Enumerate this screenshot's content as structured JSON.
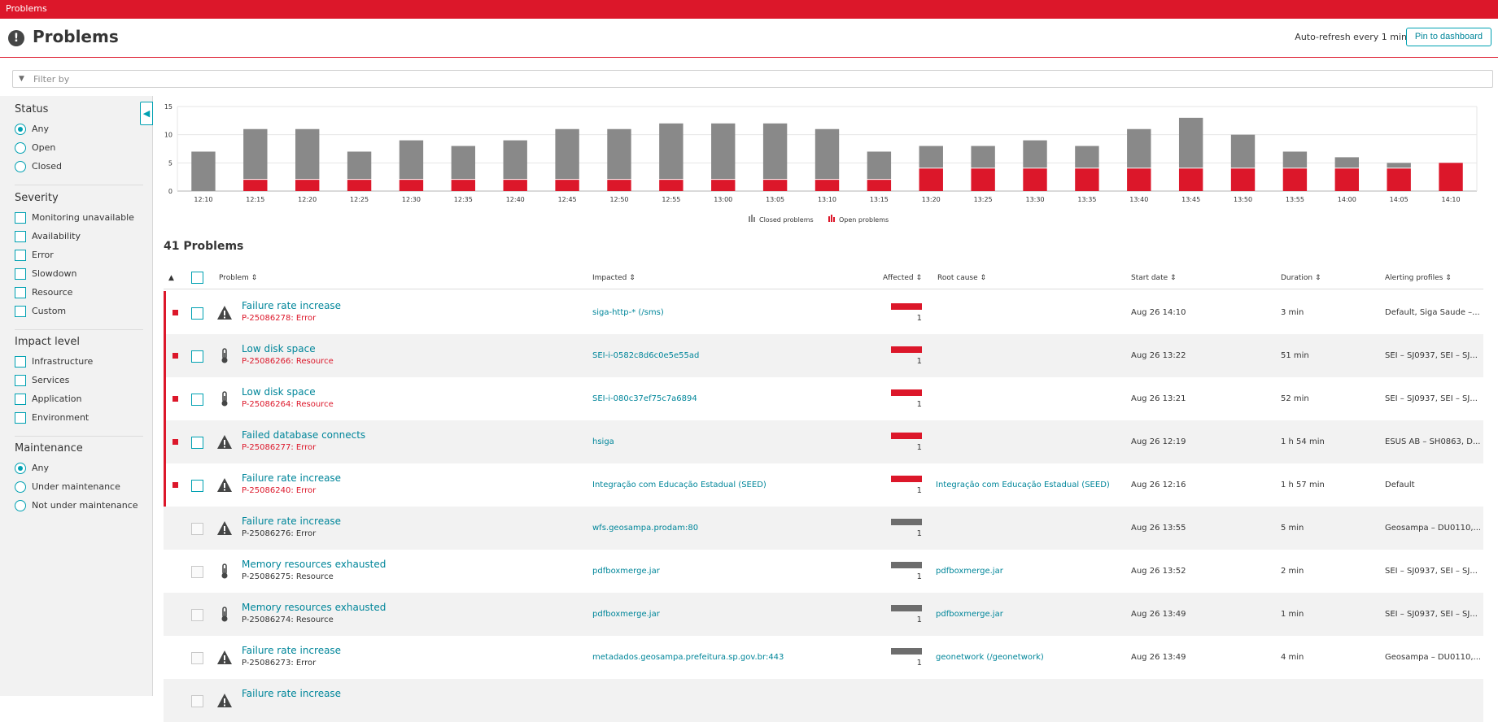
{
  "topbar": {
    "title": "Problems"
  },
  "header": {
    "title": "Problems",
    "auto_refresh": "Auto-refresh every 1 min",
    "pin_label": "Pin to dashboard"
  },
  "filter": {
    "placeholder": "Filter by"
  },
  "sidebar": {
    "status": {
      "heading": "Status",
      "options": [
        "Any",
        "Open",
        "Closed"
      ],
      "selected": "Any"
    },
    "severity": {
      "heading": "Severity",
      "options": [
        "Monitoring unavailable",
        "Availability",
        "Error",
        "Slowdown",
        "Resource",
        "Custom"
      ]
    },
    "impact": {
      "heading": "Impact level",
      "options": [
        "Infrastructure",
        "Services",
        "Application",
        "Environment"
      ]
    },
    "maintenance": {
      "heading": "Maintenance",
      "options": [
        "Any",
        "Under maintenance",
        "Not under maintenance"
      ],
      "selected": "Any"
    }
  },
  "colors": {
    "open": "#dc172a",
    "closed": "#898989",
    "accent": "#00a1b2",
    "link": "#00869a"
  },
  "chart_data": {
    "type": "bar",
    "stacked": true,
    "categories": [
      "12:10",
      "12:15",
      "12:20",
      "12:25",
      "12:30",
      "12:35",
      "12:40",
      "12:45",
      "12:50",
      "12:55",
      "13:00",
      "13:05",
      "13:10",
      "13:15",
      "13:20",
      "13:25",
      "13:30",
      "13:35",
      "13:40",
      "13:45",
      "13:50",
      "13:55",
      "14:00",
      "14:05",
      "14:10"
    ],
    "series": [
      {
        "name": "Open problems",
        "color": "#dc172a",
        "values": [
          0,
          2,
          2,
          2,
          2,
          2,
          2,
          2,
          2,
          2,
          2,
          2,
          2,
          2,
          4,
          4,
          4,
          4,
          4,
          4,
          4,
          4,
          4,
          4,
          5
        ]
      },
      {
        "name": "Closed problems",
        "color": "#898989",
        "values": [
          7,
          9,
          9,
          5,
          7,
          6,
          7,
          9,
          9,
          10,
          10,
          10,
          9,
          5,
          4,
          4,
          5,
          4,
          7,
          9,
          6,
          3,
          2,
          1,
          0
        ]
      }
    ],
    "yticks": [
      0,
      5,
      10,
      15
    ],
    "ylim": [
      0,
      15
    ],
    "grid": true,
    "legend": "bottom-center"
  },
  "table": {
    "count_label": "41 Problems",
    "columns": {
      "problem": "Problem",
      "impacted": "Impacted",
      "affected": "Affected",
      "root_cause": "Root cause",
      "start_date": "Start date",
      "duration": "Duration",
      "alerting": "Alerting profiles"
    },
    "rows": [
      {
        "open": true,
        "icon": "warning-icon",
        "title": "Failure rate increase",
        "sub": "P-25086278: Error",
        "impacted": "siga-http-* (/sms)",
        "affected": "1",
        "root_cause": "",
        "start": "Aug 26 14:10",
        "duration": "3 min",
        "alerting": "Default, Siga Saude –..."
      },
      {
        "open": true,
        "icon": "thermometer-icon",
        "title": "Low disk space",
        "sub": "P-25086266: Resource",
        "impacted": "SEI-i-0582c8d6c0e5e55ad",
        "affected": "1",
        "root_cause": "",
        "start": "Aug 26 13:22",
        "duration": "51 min",
        "alerting": "SEI – SJ0937, SEI – SJ..."
      },
      {
        "open": true,
        "icon": "thermometer-icon",
        "title": "Low disk space",
        "sub": "P-25086264: Resource",
        "impacted": "SEI-i-080c37ef75c7a6894",
        "affected": "1",
        "root_cause": "",
        "start": "Aug 26 13:21",
        "duration": "52 min",
        "alerting": "SEI – SJ0937, SEI – SJ..."
      },
      {
        "open": true,
        "icon": "warning-icon",
        "title": "Failed database connects",
        "sub": "P-25086277: Error",
        "impacted": "hsiga",
        "affected": "1",
        "root_cause": "",
        "start": "Aug 26 12:19",
        "duration": "1 h 54 min",
        "alerting": "ESUS AB – SH0863, D..."
      },
      {
        "open": true,
        "icon": "warning-icon",
        "title": "Failure rate increase",
        "sub": "P-25086240: Error",
        "impacted": "Integração com Educação Estadual (SEED)",
        "affected": "1",
        "root_cause": "Integração com Educação Estadual (SEED)",
        "start": "Aug 26 12:16",
        "duration": "1 h 57 min",
        "alerting": "Default"
      },
      {
        "open": false,
        "icon": "warning-icon",
        "title": "Failure rate increase",
        "sub": "P-25086276: Error",
        "impacted": "wfs.geosampa.prodam:80",
        "affected": "1",
        "root_cause": "",
        "start": "Aug 26 13:55",
        "duration": "5 min",
        "alerting": "Geosampa – DU0110,..."
      },
      {
        "open": false,
        "icon": "thermometer-icon",
        "title": "Memory resources exhausted",
        "sub": "P-25086275: Resource",
        "impacted": "pdfboxmerge.jar",
        "affected": "1",
        "root_cause": "pdfboxmerge.jar",
        "start": "Aug 26 13:52",
        "duration": "2 min",
        "alerting": "SEI – SJ0937, SEI – SJ..."
      },
      {
        "open": false,
        "icon": "thermometer-icon",
        "title": "Memory resources exhausted",
        "sub": "P-25086274: Resource",
        "impacted": "pdfboxmerge.jar",
        "affected": "1",
        "root_cause": "pdfboxmerge.jar",
        "start": "Aug 26 13:49",
        "duration": "1 min",
        "alerting": "SEI – SJ0937, SEI – SJ..."
      },
      {
        "open": false,
        "icon": "warning-icon",
        "title": "Failure rate increase",
        "sub": "P-25086273: Error",
        "impacted": "metadados.geosampa.prefeitura.sp.gov.br:443",
        "affected": "1",
        "root_cause": "geonetwork (/geonetwork)",
        "start": "Aug 26 13:49",
        "duration": "4 min",
        "alerting": "Geosampa – DU0110,..."
      },
      {
        "open": false,
        "icon": "warning-icon",
        "title": "Failure rate increase",
        "sub": "",
        "impacted": "",
        "affected": "",
        "root_cause": "",
        "start": "",
        "duration": "",
        "alerting": ""
      }
    ]
  }
}
